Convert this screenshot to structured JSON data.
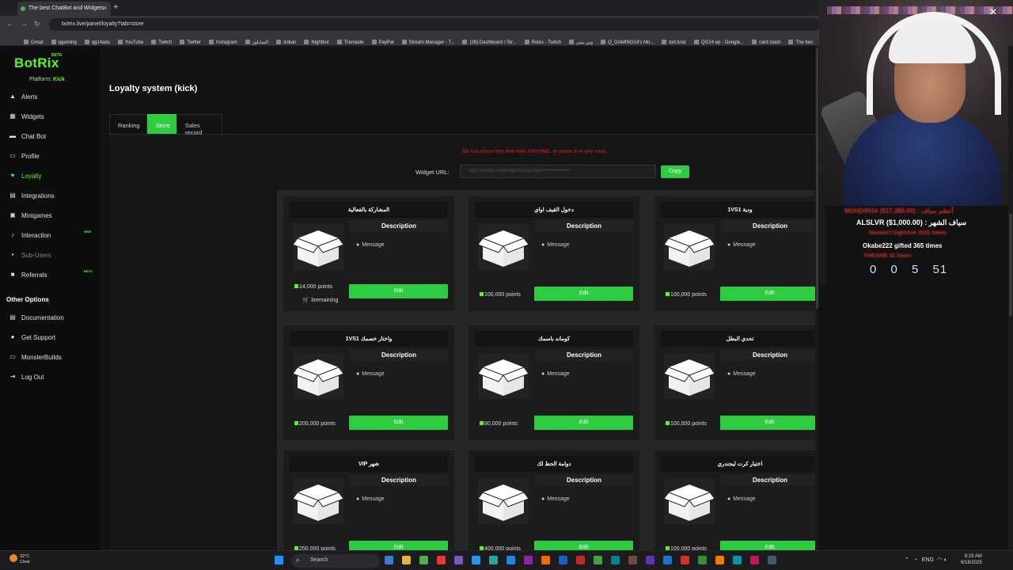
{
  "browser": {
    "tab_title": "The best ChatBot and Widgets",
    "url": "botrix.live/panel/loyalty?tab=store",
    "bookmarks": [
      "Gmail",
      "qgaming",
      "qg14ads",
      "YouTube",
      "Twitch",
      "Twitter",
      "Instagram",
      "السايلوز",
      "dokan",
      "Nightbot",
      "Translate",
      "PayPal",
      "Stream Manager - T...",
      "(28) Dashboard / Str...",
      "Roles - Twitch",
      "وين بيبي",
      "Q_GAMING14's Mo...",
      "tod.tv/ar",
      "QG14 ep - Google...",
      "card clash",
      "The bes"
    ]
  },
  "brand": {
    "name": "BotRix",
    "beta": "BETA",
    "platform_label": "Platform:",
    "platform_value": "Kick",
    "accent": "#53fc18",
    "button_green": "#2ecc40"
  },
  "sidebar": {
    "items": [
      {
        "label": "Alerts",
        "icon": "alert-icon"
      },
      {
        "label": "Widgets",
        "icon": "widgets-icon"
      },
      {
        "label": "Chat Bot",
        "icon": "chat-icon"
      },
      {
        "label": "Profile",
        "icon": "profile-icon"
      },
      {
        "label": "Loyalty",
        "icon": "loyalty-icon",
        "active": true
      },
      {
        "label": "Integrations",
        "icon": "integrations-icon"
      },
      {
        "label": "Minigames",
        "icon": "minigames-icon"
      },
      {
        "label": "Interaction",
        "icon": "interaction-icon",
        "badge": "NEW"
      },
      {
        "label": "Sub-Users",
        "icon": "subusers-icon"
      },
      {
        "label": "Referrals",
        "icon": "referrals-icon",
        "badge": "BETA"
      }
    ],
    "other_title": "Other Options",
    "other_items": [
      {
        "label": "Documentation",
        "icon": "documentation-icon"
      },
      {
        "label": "Get Support",
        "icon": "support-icon"
      },
      {
        "label": "MonsterBuilds",
        "icon": "monsterbuilds-icon"
      },
      {
        "label": "Log Out",
        "icon": "logout-icon"
      }
    ]
  },
  "main": {
    "title": "Loyalty system (kick)",
    "tabs": [
      {
        "label": "Ranking"
      },
      {
        "label": "Store",
        "active": true
      },
      {
        "label": "Sales record"
      }
    ],
    "warning": "Do not share this link with ANYONE, or paste it in any chat.",
    "widget_url_label": "Widget URL:",
    "widget_url_value": "https://botrix.live/widgets/shop?bid=••••••••••••••••",
    "copy_label": "Copy",
    "description_label": "Description",
    "message_label": "Message",
    "edit_label": "Edit",
    "items": [
      {
        "name": "المشاركة بالفعالية",
        "points": "14,000 points",
        "remaining": "3remaining"
      },
      {
        "name": "دخول القيف اواي",
        "points": "100,000 points"
      },
      {
        "name": "1VS1 ودية",
        "points": "100,000 points"
      },
      {
        "name": "1VS1 واختار خصمك",
        "points": "200,000 points"
      },
      {
        "name": "كوماند باسمك",
        "points": "80,000 points"
      },
      {
        "name": "تحدي البطل",
        "points": "100,000 points"
      },
      {
        "name": "VIP شهر",
        "points": "250,000 points"
      },
      {
        "name": "دوامة الحظ لك",
        "points": "400,000 points"
      },
      {
        "name": "اختيار كرت ليجندري",
        "points": "100,000 points"
      }
    ]
  },
  "stream_overlay": {
    "line1": "MOHD8934 ($17,380.00) : أعظم سياف",
    "line2": "ALSLVR ($1,000.00) : سياف الشهر",
    "line3": "HaneenYSightAve 3531 times",
    "line4": "Okabe222 gifted 365 times",
    "line5": "FHEAME 32 times",
    "timer": [
      "0",
      "0",
      "5",
      "51"
    ]
  },
  "taskbar": {
    "temp": "32°C",
    "weather": "Clear",
    "search": "Search",
    "lang": "ENG",
    "time": "8:23 AM",
    "date": "9/18/2025"
  }
}
